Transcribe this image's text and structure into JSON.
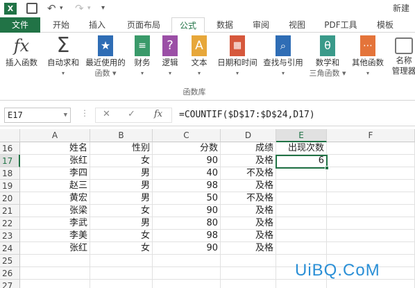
{
  "title": "新建",
  "tabs": [
    "文件",
    "开始",
    "插入",
    "页面布局",
    "公式",
    "数据",
    "审阅",
    "视图",
    "PDF工具",
    "模板"
  ],
  "active_tab": "公式",
  "ribbon": {
    "buttons": [
      {
        "label1": "插入函数",
        "label2": "",
        "icon": "fx-icon"
      },
      {
        "label1": "自动求和",
        "label2": "▾",
        "icon": "sigma-icon"
      },
      {
        "label1": "最近使用的",
        "label2": "函数 ▾",
        "icon": "star-book-icon"
      },
      {
        "label1": "财务",
        "label2": "▾",
        "icon": "coins-book-icon"
      },
      {
        "label1": "逻辑",
        "label2": "▾",
        "icon": "question-book-icon"
      },
      {
        "label1": "文本",
        "label2": "▾",
        "icon": "text-book-icon"
      },
      {
        "label1": "日期和时间",
        "label2": "▾",
        "icon": "calendar-book-icon"
      },
      {
        "label1": "查找与引用",
        "label2": "▾",
        "icon": "search-book-icon"
      },
      {
        "label1": "数学和",
        "label2": "三角函数 ▾",
        "icon": "theta-book-icon"
      },
      {
        "label1": "其他函数",
        "label2": "▾",
        "icon": "more-book-icon"
      },
      {
        "label1": "名称",
        "label2": "管理器",
        "icon": "name-manager-icon"
      }
    ],
    "group_label": "函数库"
  },
  "formula_bar": {
    "name_box": "E17",
    "cancel_symbol": "✕",
    "enter_symbol": "✓",
    "fx_symbol": "fx",
    "formula": "=COUNTIF($D$17:$D$24,D17)"
  },
  "columns": [
    "A",
    "B",
    "C",
    "D",
    "E",
    "F"
  ],
  "rows": [
    {
      "num": "16",
      "a": "姓名",
      "b": "性别",
      "c": "分数",
      "d": "成绩",
      "e": "出现次数"
    },
    {
      "num": "17",
      "a": "张红",
      "b": "女",
      "c": "90",
      "d": "及格",
      "e": "6"
    },
    {
      "num": "18",
      "a": "李四",
      "b": "男",
      "c": "40",
      "d": "不及格",
      "e": ""
    },
    {
      "num": "19",
      "a": "赵三",
      "b": "男",
      "c": "98",
      "d": "及格",
      "e": ""
    },
    {
      "num": "20",
      "a": "黄宏",
      "b": "男",
      "c": "50",
      "d": "不及格",
      "e": ""
    },
    {
      "num": "21",
      "a": "张梁",
      "b": "女",
      "c": "90",
      "d": "及格",
      "e": ""
    },
    {
      "num": "22",
      "a": "李武",
      "b": "男",
      "c": "80",
      "d": "及格",
      "e": ""
    },
    {
      "num": "23",
      "a": "李美",
      "b": "女",
      "c": "98",
      "d": "及格",
      "e": ""
    },
    {
      "num": "24",
      "a": "张红",
      "b": "女",
      "c": "90",
      "d": "及格",
      "e": ""
    },
    {
      "num": "25",
      "a": "",
      "b": "",
      "c": "",
      "d": "",
      "e": ""
    },
    {
      "num": "26",
      "a": "",
      "b": "",
      "c": "",
      "d": "",
      "e": ""
    },
    {
      "num": "27",
      "a": "",
      "b": "",
      "c": "",
      "d": "",
      "e": ""
    }
  ],
  "watermark": "UiBQ.CoM",
  "colors": {
    "accent": "#217346",
    "watermark": "#2a8fd6"
  }
}
